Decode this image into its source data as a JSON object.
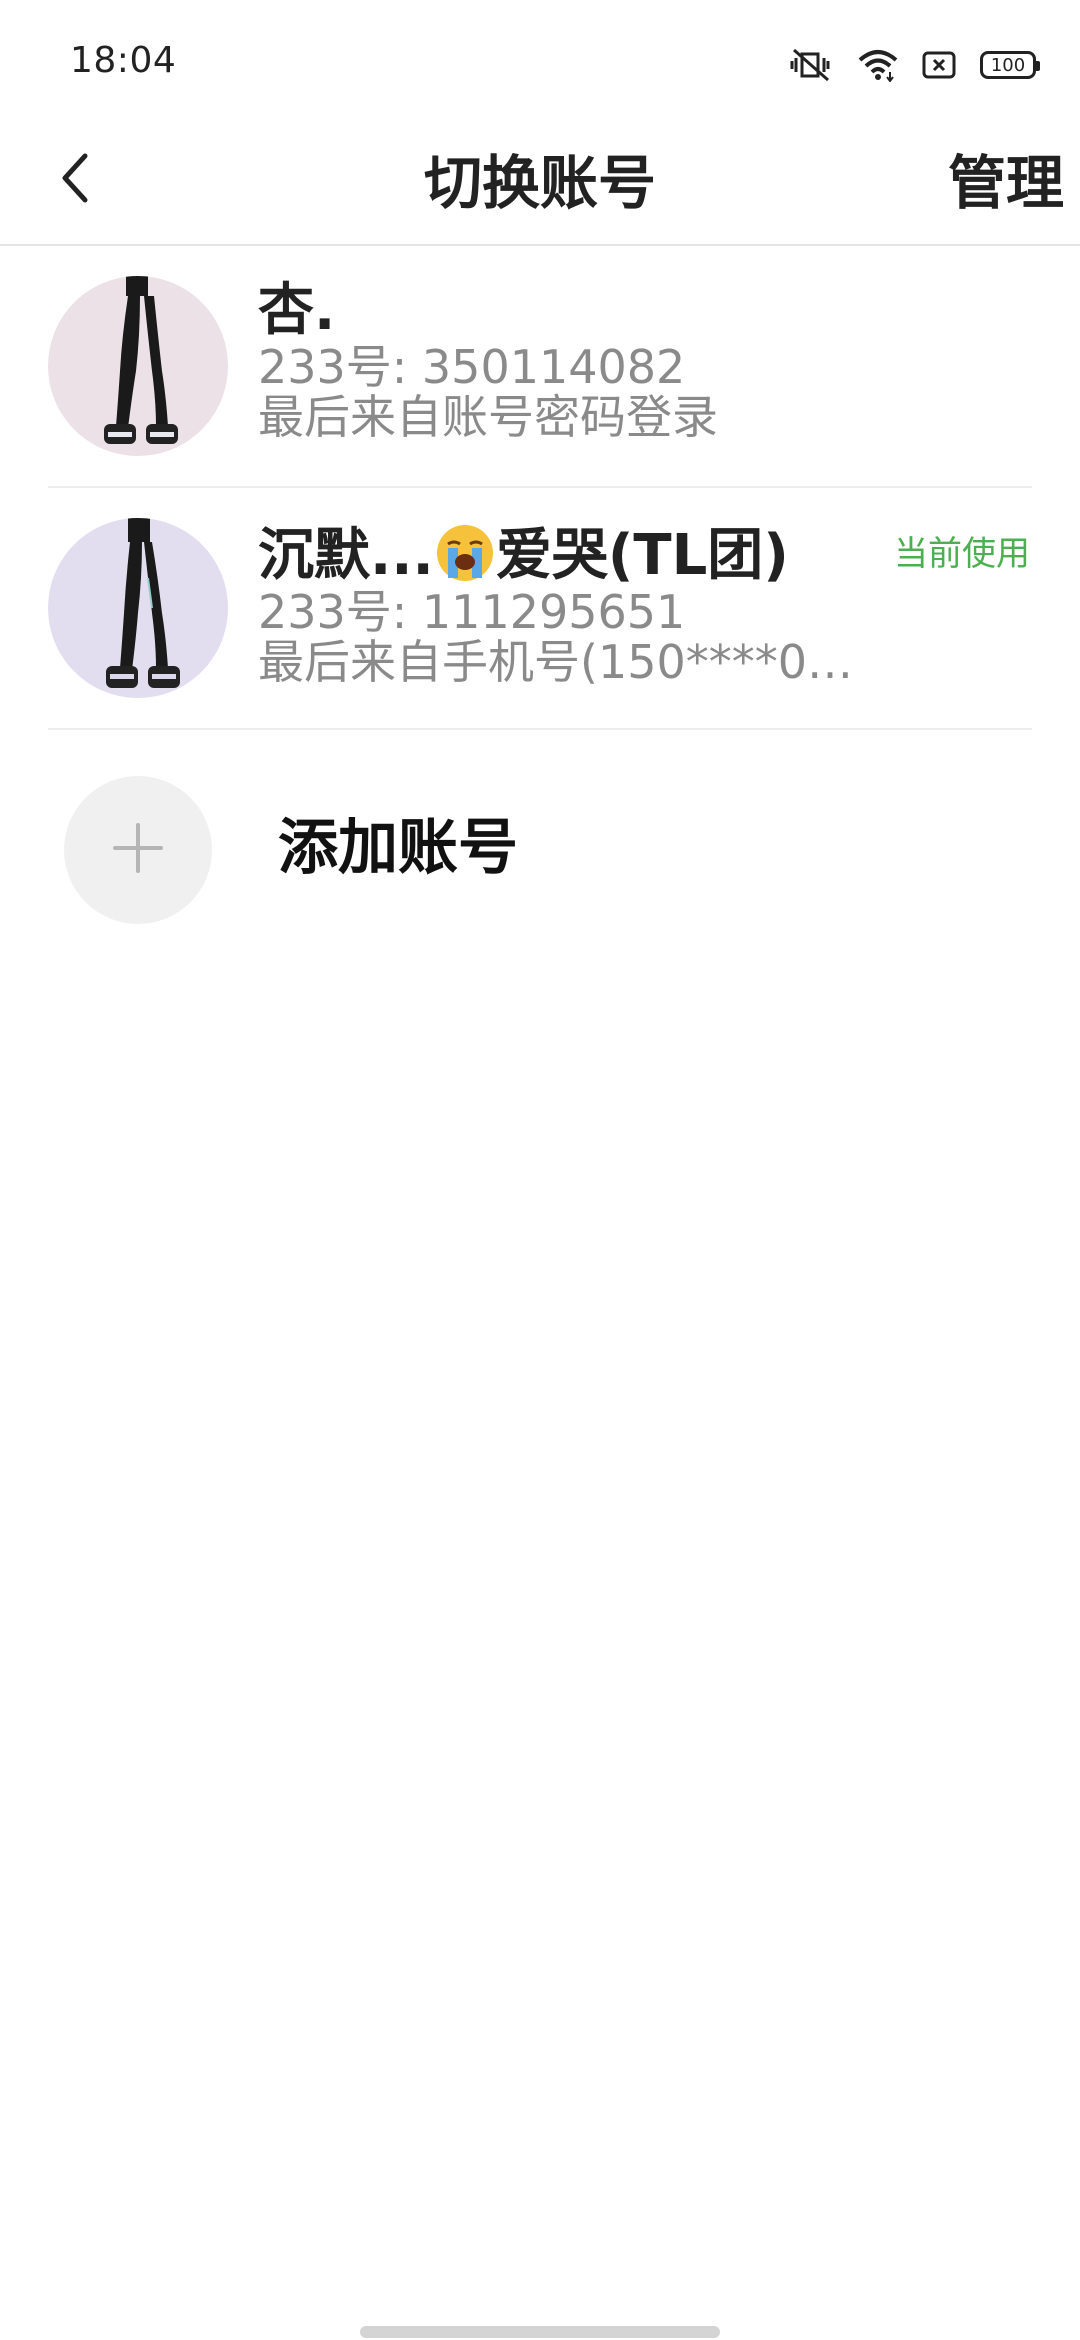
{
  "status_bar": {
    "time": "18:04",
    "battery": "100",
    "icons": [
      "mute-vibrate-icon",
      "wifi-icon",
      "sim-off-icon",
      "battery-icon"
    ]
  },
  "header": {
    "title": "切换账号",
    "manage_label": "管理",
    "back_icon": "chevron-left-icon"
  },
  "accounts": [
    {
      "name": "杏.",
      "id_text": "233号: 350114082",
      "login_text": "最后来自账号密码登录",
      "current_label": ""
    },
    {
      "name_prefix": "沉默...",
      "name_emoji": "loudly-crying-face",
      "name_suffix": "爱哭(TL团)",
      "id_text": "233号: 111295651",
      "login_text": "最后来自手机号(150****02...",
      "current_label": "当前使用"
    }
  ],
  "add_account": {
    "label": "添加账号",
    "icon": "plus-icon"
  },
  "colors": {
    "accent_green": "#4caf50",
    "text_primary": "#222222",
    "text_secondary": "#8a8a8a",
    "divider": "#ececec"
  }
}
